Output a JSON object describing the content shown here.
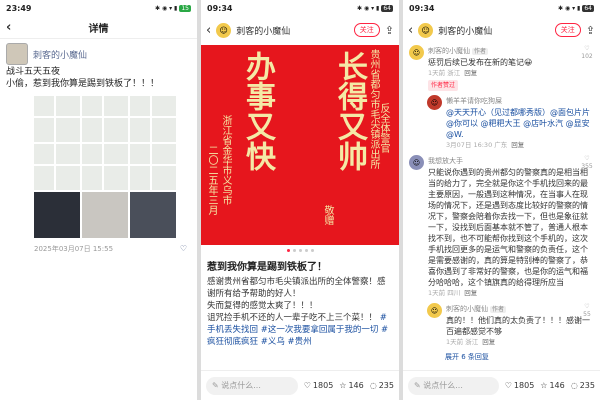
{
  "p1": {
    "time": "23:49",
    "batt": "15",
    "title": "详情",
    "name": "刺客的小魔仙",
    "text": "战斗五天五夜\n小偷，惹到我你算是踢到铁板了！！！",
    "date": "2025年03月07日 15:55",
    "like": "♡"
  },
  "p2": {
    "time": "09:34",
    "batt": "64",
    "user": "刺客的小魔仙",
    "follow": "关注",
    "img_big1": "办事又快",
    "img_big2": "长得又帅",
    "img_small1": "浙江省金华市义乌市",
    "img_small2": "二〇二五年三月",
    "img_small3": "敬赠",
    "img_small4": "贵州省都匀市毛尖镇派出所",
    "img_small5": "反全体警官",
    "title": "惹到我你算是踢到铁板了！",
    "body": "感谢贵州省都匀市毛尖镇派出所的全体警察！感谢所有给予帮助的好人！\n失而复得的感觉太爽了！！！\n诅咒捡手机不还的人一辈子吃不上三个菜！！",
    "tags": "#手机丢失找回 #这一次我要拿回属于我的一切 #疯狂彻底疯狂 #义乌 #贵州",
    "input": "说点什么...",
    "likes": "1805",
    "stars": "146",
    "cmts": "235"
  },
  "p3": {
    "time": "09:34",
    "batt": "64",
    "user": "刺客的小魔仙",
    "follow": "关注",
    "c1_name": "刺客的小魔仙",
    "c1_tag": "作者",
    "c1_text": "惩罚后续已发布在新的笔记😀",
    "c1_meta": "1天前 浙江",
    "c1_reply": "回复",
    "c1_like": "102",
    "pill": "作者赞过",
    "c2_name": "懒羊羊请你吃狗屎",
    "c2_text": "@天天开心（见过都哪秀版）@面包片片 @你可以 @粑粑大王 @店叶水汽 @显安 @W.",
    "c2_meta": "3月07日 16:30 广东",
    "c2_reply": "回复",
    "c3_name": "我想放大手",
    "c3_text": "只能说你遇到的贵州都匀的警察真的是相当相当的给力了，完全就是你这个手机找回来的最主要原因，一般遇到这种情况，在当事人在现场的情况下，还是遇到态度比较好的警察的情况下，警察会陪着你去找一下，但也是象征就一下，没找到后面基本就不管了，普通人根本找不到，也不可能帮你找到这个手机的，这次手机找回更多的是运气和警察的负责任，这个是需要感谢的，真的算是特别棒的警察了，恭喜你遇到了非常好的警察，也是你的运气和福分哈哈哈，这个镇旗真的给得理所应当",
    "c3_meta": "1天前 四川",
    "c3_reply": "回复",
    "c3_like": "355",
    "c4_name": "刺客的小魔仙",
    "c4_tag": "作者",
    "c4_text": "真的！！他们真的太负责了！！！感谢一百遍都感觉不够",
    "c4_meta": "1天前 浙江",
    "c4_reply": "回复",
    "c4_like": "55",
    "more": "展开 6 条回复",
    "input": "说点什么...",
    "likes": "1805",
    "stars": "146",
    "cmts": "235"
  }
}
